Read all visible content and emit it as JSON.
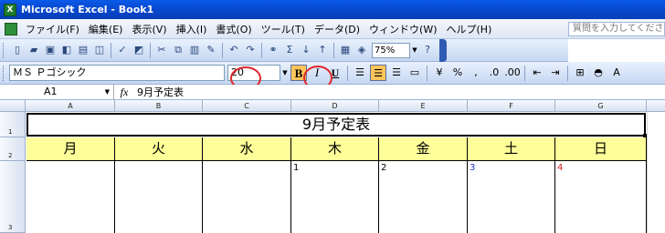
{
  "window": {
    "title": "Microsoft Excel - Book1",
    "app_icon_text": "X"
  },
  "menu": {
    "items": [
      "ファイル(F)",
      "編集(E)",
      "表示(V)",
      "挿入(I)",
      "書式(O)",
      "ツール(T)",
      "データ(D)",
      "ウィンドウ(W)",
      "ヘルプ(H)"
    ],
    "help_placeholder": "質問を入力してくださ"
  },
  "toolbar": {
    "icons": [
      "new-icon",
      "open-icon",
      "save-icon",
      "permission-icon",
      "print-icon",
      "print-preview-icon",
      "spelling-icon",
      "research-icon",
      "cut-icon",
      "copy-icon",
      "paste-icon",
      "format-painter-icon",
      "undo-icon",
      "redo-icon",
      "hyperlink-icon",
      "autosum-icon",
      "sort-ascending-icon",
      "sort-descending-icon",
      "chart-wizard-icon",
      "drawing-icon"
    ],
    "zoom": "75%"
  },
  "format": {
    "font": "ＭＳ Ｐゴシック",
    "size": "20",
    "bold": "B",
    "italic": "I",
    "underline": "U",
    "percent": "%",
    "comma": ",",
    "dec_inc": ".0",
    "dec_dec": ".00"
  },
  "formula": {
    "cell_ref": "A1",
    "fx": "fx",
    "content": "9月予定表"
  },
  "grid": {
    "columns": [
      "A",
      "B",
      "C",
      "D",
      "E",
      "F",
      "G"
    ],
    "rows": [
      "1",
      "2",
      "3"
    ],
    "title": "9月予定表",
    "weekdays": [
      "月",
      "火",
      "水",
      "木",
      "金",
      "土",
      "日"
    ],
    "dates": [
      "",
      "",
      "",
      "1",
      "2",
      "3",
      "4"
    ]
  },
  "colors": {
    "accent_header": "#ffff99",
    "saturday": "#2433d4",
    "sunday": "#e02020",
    "highlight": "#e0242a",
    "bold_active": "#ffc55a"
  }
}
